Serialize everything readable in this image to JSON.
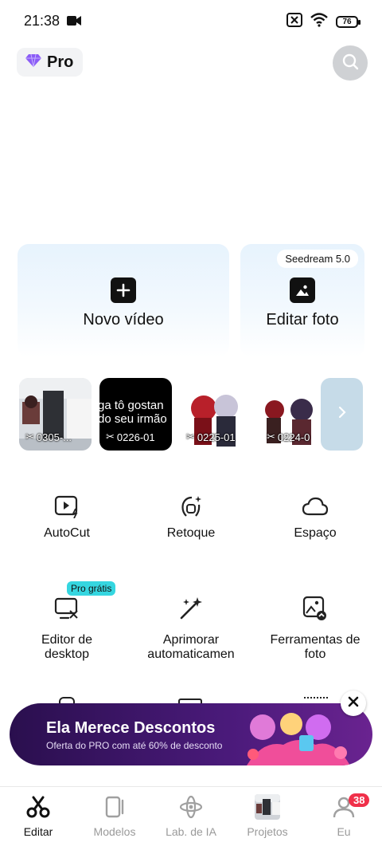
{
  "status_bar": {
    "time": "21:38",
    "battery": "76"
  },
  "header": {
    "pro_label": "Pro"
  },
  "cards": [
    {
      "label": "Novo vídeo"
    },
    {
      "label": "Editar foto",
      "tag": "Seedream 5.0"
    }
  ],
  "recent_projects": [
    {
      "caption": "0305-..."
    },
    {
      "caption": "0226-01",
      "overlay_text": "ga tô gostan do seu irmão"
    },
    {
      "caption": "0225-01"
    },
    {
      "caption": "0224-0"
    }
  ],
  "tools": [
    {
      "label": "AutoCut",
      "icon": "autocut-icon"
    },
    {
      "label": "Retoque",
      "icon": "retouch-icon"
    },
    {
      "label": "Espaço",
      "icon": "cloud-icon"
    },
    {
      "label": "Editor de desktop",
      "icon": "desktop-icon",
      "badge": "Pro grátis"
    },
    {
      "label": "Aprimorar automaticamen",
      "icon": "magic-wand-icon"
    },
    {
      "label": "Ferramentas de foto",
      "icon": "photo-tools-icon"
    }
  ],
  "promo": {
    "title": "Ela Merece Descontos",
    "subtitle": "Oferta do PRO com até 60% de desconto"
  },
  "bottom_nav": [
    {
      "label": "Editar",
      "active": true
    },
    {
      "label": "Modelos"
    },
    {
      "label": "Lab. de IA"
    },
    {
      "label": "Projetos"
    },
    {
      "label": "Eu",
      "badge": "38"
    }
  ],
  "colors": {
    "accent_cyan": "#35d6e0",
    "badge_red": "#f0304a",
    "promo_purple": "#4a1a7a",
    "pro_gem": "#8b5cf6"
  }
}
